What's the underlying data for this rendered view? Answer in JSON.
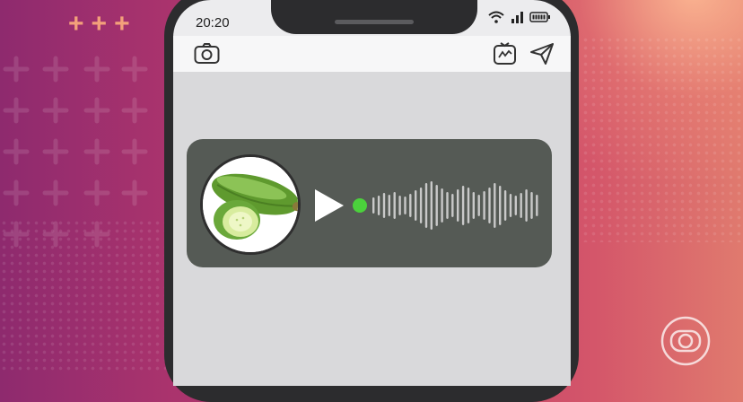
{
  "status_bar": {
    "time": "20:20",
    "icons": [
      "wifi-icon",
      "signal-icon",
      "battery-icon"
    ]
  },
  "top_bar": {
    "left_icon": "camera-icon",
    "right_icons": [
      "tv-icon",
      "send-icon"
    ]
  },
  "message": {
    "type": "audio",
    "avatar": "zucchini-image",
    "control": "play-icon",
    "state_indicator_color": "#4bd13c"
  },
  "decor": {
    "pluses": [
      "+",
      "+",
      "+"
    ],
    "watermark": "globo-logo"
  },
  "colors": {
    "bubble": "#555a55",
    "indicator": "#4bd13c",
    "background_start": "#8e2a6e",
    "background_end": "#e07a6e"
  }
}
